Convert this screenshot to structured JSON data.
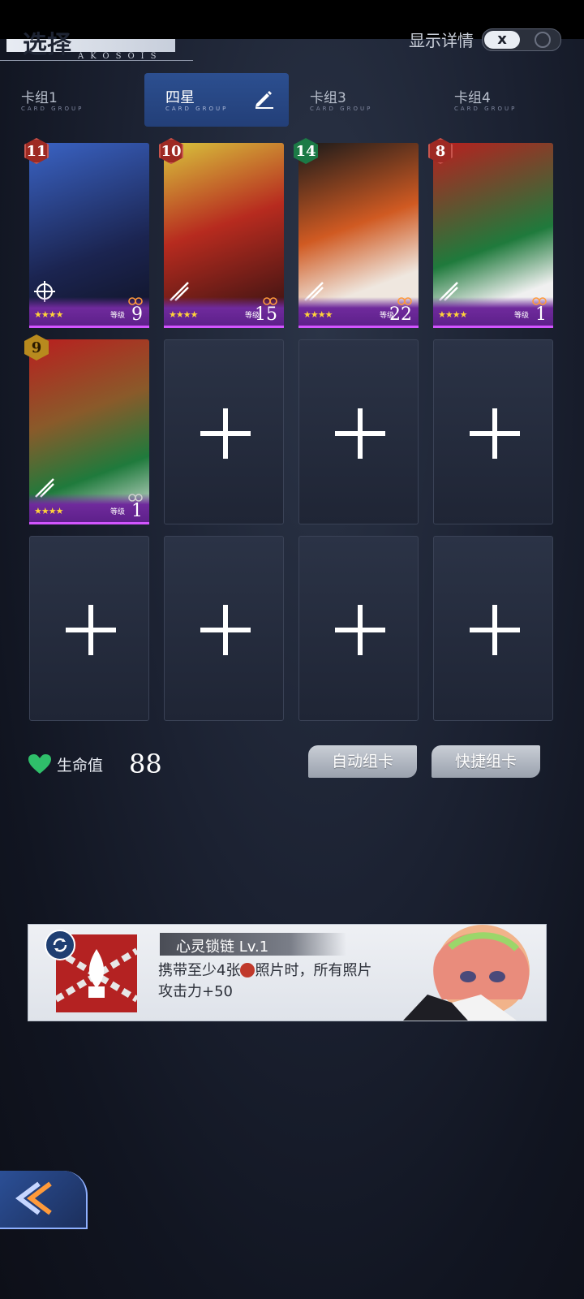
{
  "header": {
    "title": "选择",
    "subtitle": "AKOSOIS",
    "details_label": "显示详情",
    "details_toggle_state": "x"
  },
  "tabs": [
    {
      "label": "卡组1",
      "sub": "CARD GROUP"
    },
    {
      "label": "四星",
      "sub": "CARD GROUP",
      "active": true
    },
    {
      "label": "卡组3",
      "sub": "CARD GROUP"
    },
    {
      "label": "卡组4",
      "sub": "CARD GROUP"
    }
  ],
  "cards": [
    {
      "badge": "11",
      "badge_color": "red",
      "stars": "★★★★",
      "level_label": "等级",
      "level": "9",
      "art_color": "#2a4f9a"
    },
    {
      "badge": "10",
      "badge_color": "red",
      "stars": "★★★★",
      "level_label": "等级",
      "level": "15",
      "art_color": "#b72b1f"
    },
    {
      "badge": "14",
      "badge_color": "green",
      "stars": "★★★★",
      "level_label": "等级",
      "level": "22",
      "art_color": "#d8d8d8"
    },
    {
      "badge": "8",
      "badge_color": "red",
      "stars": "★★★★",
      "level_label": "等级",
      "level": "1",
      "art_color": "#1f7a3c"
    },
    {
      "badge": "9",
      "badge_color": "gold",
      "stars": "★★★★",
      "level_label": "等级",
      "level": "1",
      "art_color": "#1f7a3c"
    }
  ],
  "hp": {
    "label": "生命值",
    "value": "88"
  },
  "buttons": {
    "auto": "自动组卡",
    "quick": "快捷组卡"
  },
  "skill": {
    "title": "心灵锁链 Lv.1",
    "desc_part1": "携带至少4张",
    "desc_part2": "照片时，所有照片",
    "desc_part3": "攻击力+50"
  },
  "colors": {
    "accent_tab": "#2c4f90",
    "card_bottom": "#6f2a9c",
    "heart": "#2fbf6a"
  }
}
